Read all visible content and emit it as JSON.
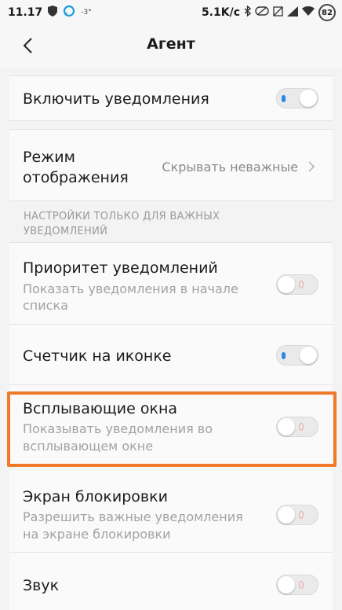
{
  "status": {
    "time": "11.17",
    "signal_small": "-3°",
    "speed": "5.1K/c",
    "battery": "82"
  },
  "header": {
    "title": "Агент"
  },
  "settings": {
    "enable_notifications": {
      "label": "Включить уведомления",
      "on": true
    },
    "display_mode": {
      "label_line1": "Режим",
      "label_line2": "отображения",
      "value": "Скрывать неважные"
    },
    "section_header_line1": "НАСТРОЙКИ ТОЛЬКО ДЛЯ ВАЖНЫХ",
    "section_header_line2": "УВЕДОМЛЕНИЙ",
    "priority": {
      "label": "Приоритет уведомлений",
      "sub_line1": "Показать уведомления в начале",
      "sub_line2": "списка",
      "on": false
    },
    "badge": {
      "label": "Счетчик на иконке",
      "on": true
    },
    "popup": {
      "label": "Всплывающие окна",
      "sub_line1": "Показывать уведомления во",
      "sub_line2": "всплывающем окне",
      "on": false
    },
    "lockscreen": {
      "label": "Экран блокировки",
      "sub_line1": "Разрешить важные уведомления",
      "sub_line2": "на экране блокировки",
      "on": false
    },
    "sound": {
      "label": "Звук",
      "on": false
    }
  },
  "colors": {
    "highlight": "#f07a2a",
    "toggle_on_dot": "#2d86e8"
  }
}
